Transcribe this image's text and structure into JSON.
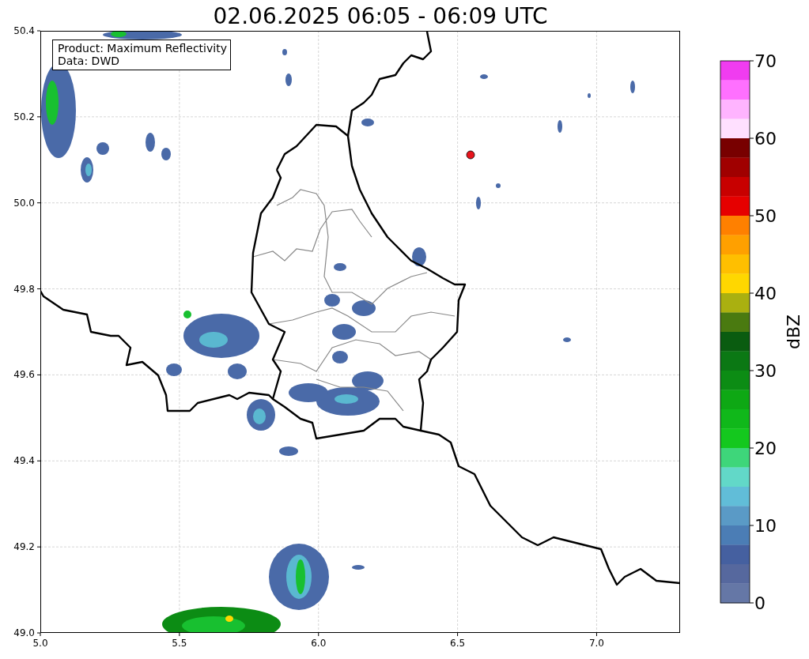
{
  "title": "02.06.2025 06:05 - 06:09 UTC",
  "legend": [
    "Product: Maximum Reflectivity",
    "Data: DWD"
  ],
  "axes": {
    "y_ticks": [
      "50.4",
      "50.2",
      "50.0",
      "49.8",
      "49.6",
      "49.4",
      "49.2",
      "49.0"
    ],
    "x_ticks": [
      "5.0",
      "5.5",
      "6.0",
      "6.5",
      "7.0"
    ]
  },
  "colorbar": {
    "label": "dBZ",
    "ticks": [
      "70",
      "60",
      "50",
      "40",
      "30",
      "20",
      "10",
      "0"
    ],
    "segments": [
      {
        "color": "#f03cf0"
      },
      {
        "color": "#ff70ff"
      },
      {
        "color": "#ffb4ff"
      },
      {
        "color": "#ffe0ff"
      },
      {
        "color": "#780000"
      },
      {
        "color": "#a00000"
      },
      {
        "color": "#c80000"
      },
      {
        "color": "#e60000"
      },
      {
        "color": "#ff8000"
      },
      {
        "color": "#ffa000"
      },
      {
        "color": "#ffbf00"
      },
      {
        "color": "#ffd700"
      },
      {
        "color": "#aab010"
      },
      {
        "color": "#4a7a10"
      },
      {
        "color": "#0a5c10"
      },
      {
        "color": "#0b7814"
      },
      {
        "color": "#0c8c14"
      },
      {
        "color": "#0ea814"
      },
      {
        "color": "#10b81a"
      },
      {
        "color": "#14c81e"
      },
      {
        "color": "#3ed67a"
      },
      {
        "color": "#62d8c8"
      },
      {
        "color": "#61bdd8"
      },
      {
        "color": "#5a9ac6"
      },
      {
        "color": "#4b7db5"
      },
      {
        "color": "#4560a0"
      },
      {
        "color": "#56689e"
      },
      {
        "color": "#6577a6"
      }
    ]
  }
}
